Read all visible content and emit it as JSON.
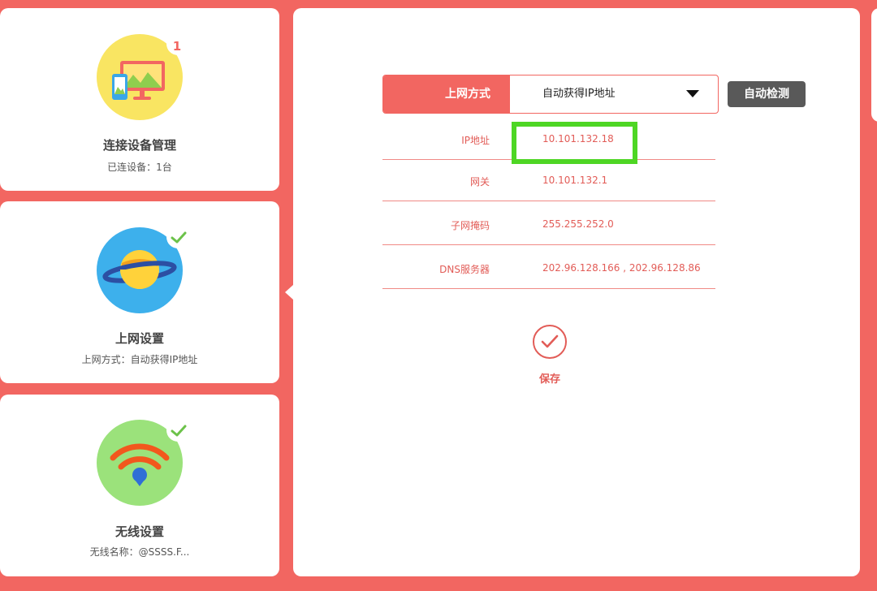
{
  "sidebar": {
    "cards": [
      {
        "title": "连接设备管理",
        "subtitle": "已连设备：1台",
        "badge": "1",
        "icon": "devices-icon",
        "color": "#f9e562"
      },
      {
        "title": "上网设置",
        "subtitle": "上网方式：自动获得IP地址",
        "badge": "check",
        "icon": "planet-icon",
        "color": "#3db0ec",
        "active": true
      },
      {
        "title": "无线设置",
        "subtitle": "无线名称：@SSSS.F...",
        "badge": "check",
        "icon": "wifi-icon",
        "color": "#9be27b"
      }
    ]
  },
  "main": {
    "mode": {
      "label": "上网方式",
      "value": "自动获得IP地址"
    },
    "detect_button": "自动检测",
    "rows": [
      {
        "label": "IP地址",
        "value": "10.101.132.18"
      },
      {
        "label": "网关",
        "value": "10.101.132.1"
      },
      {
        "label": "子网掩码",
        "value": "255.255.252.0"
      },
      {
        "label": "DNS服务器",
        "value": "202.96.128.166 , 202.96.128.86"
      }
    ],
    "save_label": "保存"
  },
  "colors": {
    "accent": "#f26661",
    "highlight": "#4ed624",
    "button_dark": "#595959"
  }
}
